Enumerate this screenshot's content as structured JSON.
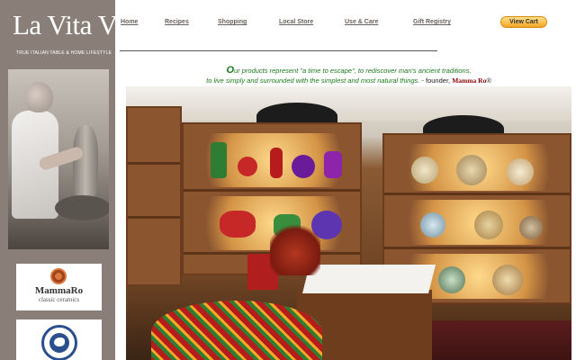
{
  "brand": {
    "logo_text": "La Vita Vera",
    "logo_tm": "™",
    "tagline": "TRUE ITALIAN TABLE & HOME LIFESTYLE"
  },
  "nav": {
    "items": [
      {
        "label": "Home"
      },
      {
        "label": "Recipes"
      },
      {
        "label": "Shopping"
      },
      {
        "label": "Local Store"
      },
      {
        "label": "Use & Care"
      },
      {
        "label": "Gift Registry"
      }
    ],
    "cart_label": "View Cart",
    "cart_color": "#f5a623"
  },
  "sidebar": {
    "mammaro_name": "MammaRo",
    "mammaro_sub": "classic ceramics"
  },
  "main": {
    "tagline_o": "O",
    "tagline_line1": "ur products represent \"a time to escape\", to rediscover man's ancient traditions,",
    "tagline_line2": "to live simply and surrounded with the simplest and most natural things.",
    "founder_prefix": " - founder, ",
    "founder_brand": "Mamma Ro",
    "founder_tm": "®",
    "tagline_color": "#1a7a1a"
  }
}
